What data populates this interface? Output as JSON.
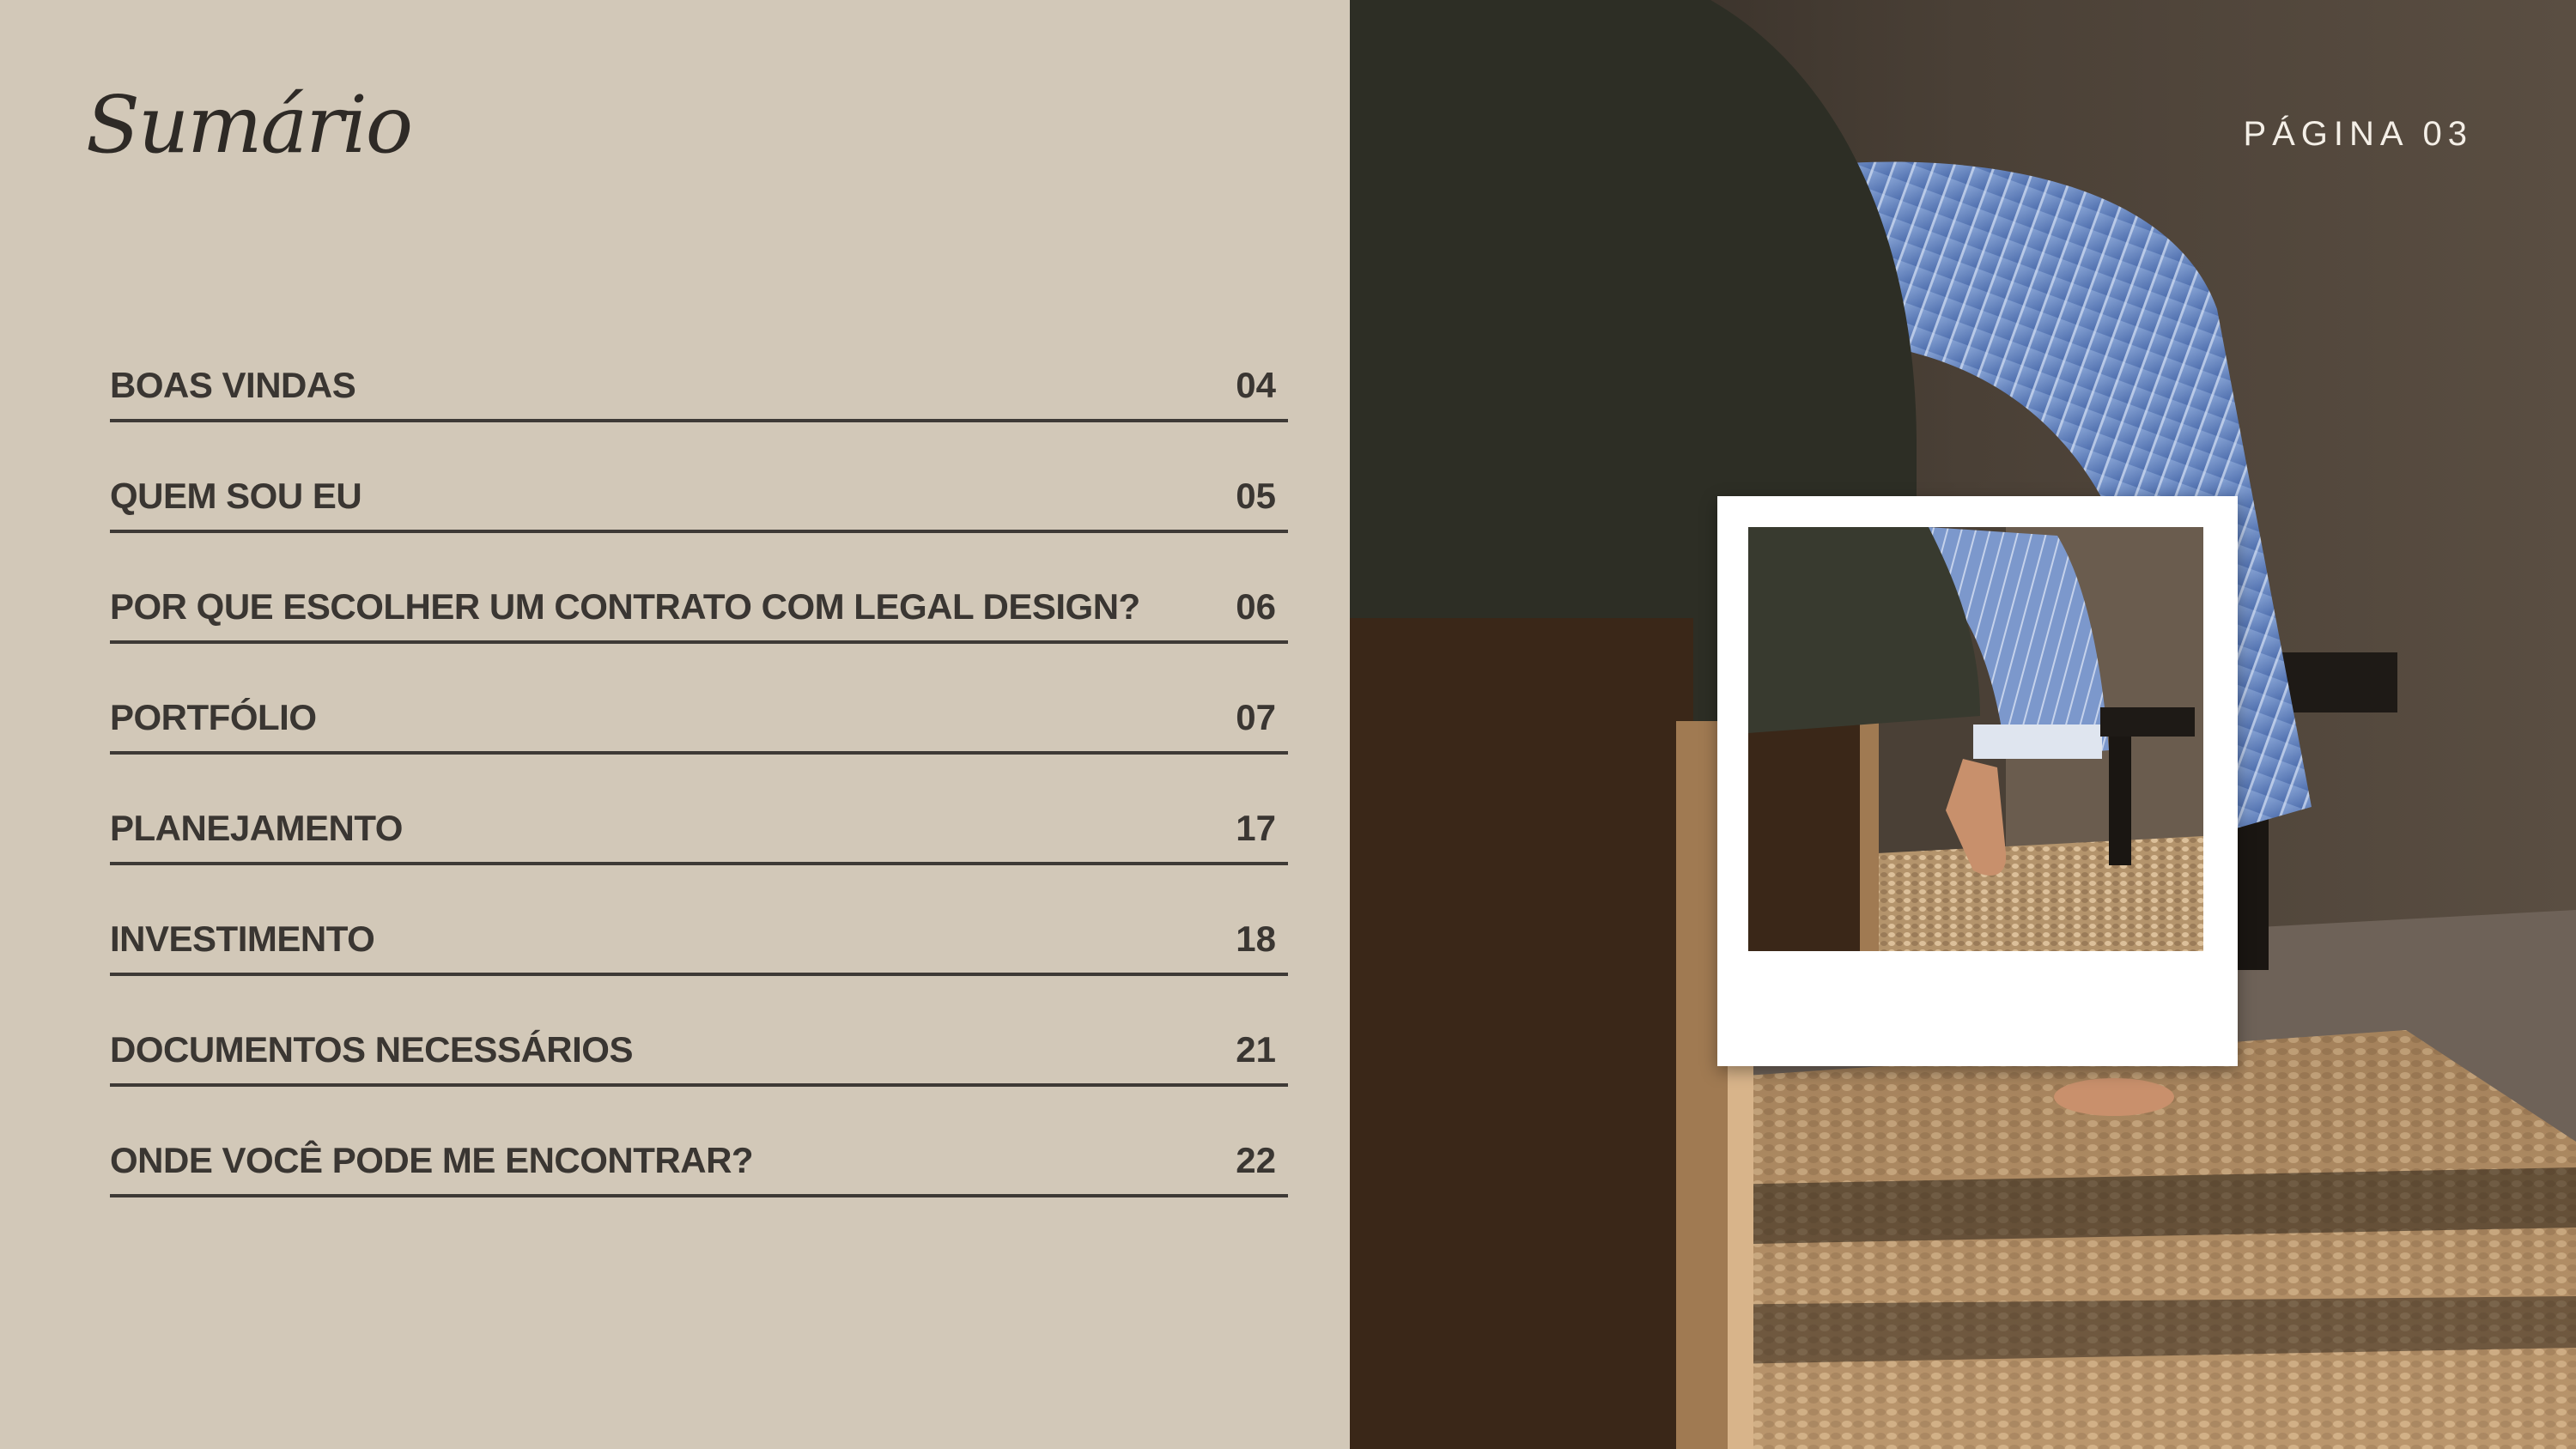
{
  "header": {
    "title": "Sumário",
    "page_label": "PÁGINA 03"
  },
  "toc": [
    {
      "label": "BOAS VINDAS",
      "page": "04"
    },
    {
      "label": "QUEM SOU EU",
      "page": "05"
    },
    {
      "label": "POR QUE ESCOLHER UM CONTRATO COM LEGAL DESIGN?",
      "page": "06"
    },
    {
      "label": "PORTFÓLIO",
      "page": "07"
    },
    {
      "label": "PLANEJAMENTO",
      "page": "17"
    },
    {
      "label": "INVESTIMENTO",
      "page": "18"
    },
    {
      "label": "DOCUMENTOS NECESSÁRIOS",
      "page": "21"
    },
    {
      "label": "ONDE VOCÊ PODE ME ENCONTRAR?",
      "page": "22"
    }
  ],
  "colors": {
    "background": "#d2c8b8",
    "text": "#3a3632",
    "rule": "#3e3a36",
    "page_label": "#f4efe7"
  }
}
